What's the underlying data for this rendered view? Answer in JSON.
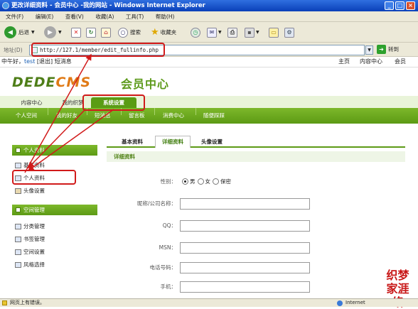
{
  "window": {
    "title": "更改详细资料 - 会员中心 -我的网站 - Windows Internet Explorer"
  },
  "menu": [
    "文件(F)",
    "编辑(E)",
    "查看(V)",
    "收藏(A)",
    "工具(T)",
    "帮助(H)"
  ],
  "toolbar": {
    "back": "后退",
    "search": "搜索",
    "favorites": "收藏夹"
  },
  "address": {
    "label": "地址(D)",
    "url": "http://127.1/member/edit_fullinfo.php",
    "go": "转到"
  },
  "topbar": {
    "greeting": "中午好，",
    "user": "test",
    "logout": "[退出]",
    "sms": "短消息",
    "links": [
      "主页",
      "内容中心",
      "会员"
    ]
  },
  "logo": {
    "dede": "DEDE",
    "cms": "CMS",
    "member": "会员中心"
  },
  "nav": {
    "tabs": [
      "内容中心",
      "我的织梦",
      "系统设置"
    ]
  },
  "subnav": [
    "个人空间",
    "我的好友",
    "短消息",
    "留言板",
    "消费中心",
    "随便踩踩"
  ],
  "sidebar": {
    "group1": "个人资料",
    "group1_items": [
      "基本资料",
      "个人资料",
      "头像设置"
    ],
    "group2": "空间管理",
    "group2_items": [
      "分类管理",
      "书签管理",
      "空间设置",
      "风格选择"
    ]
  },
  "content": {
    "tabs": [
      "基本资料",
      "详细资料",
      "头像设置"
    ],
    "section": "详细资料",
    "gender_label": "性别：",
    "gender_options": [
      "男",
      "女",
      "保密"
    ],
    "fields": [
      "昵称/公司名称：",
      "QQ：",
      "MSN：",
      "电话号码：",
      "手机："
    ]
  },
  "statusbar": {
    "left": "网页上有错误。",
    "right": "Internet"
  },
  "watermark": "织梦家涯络"
}
